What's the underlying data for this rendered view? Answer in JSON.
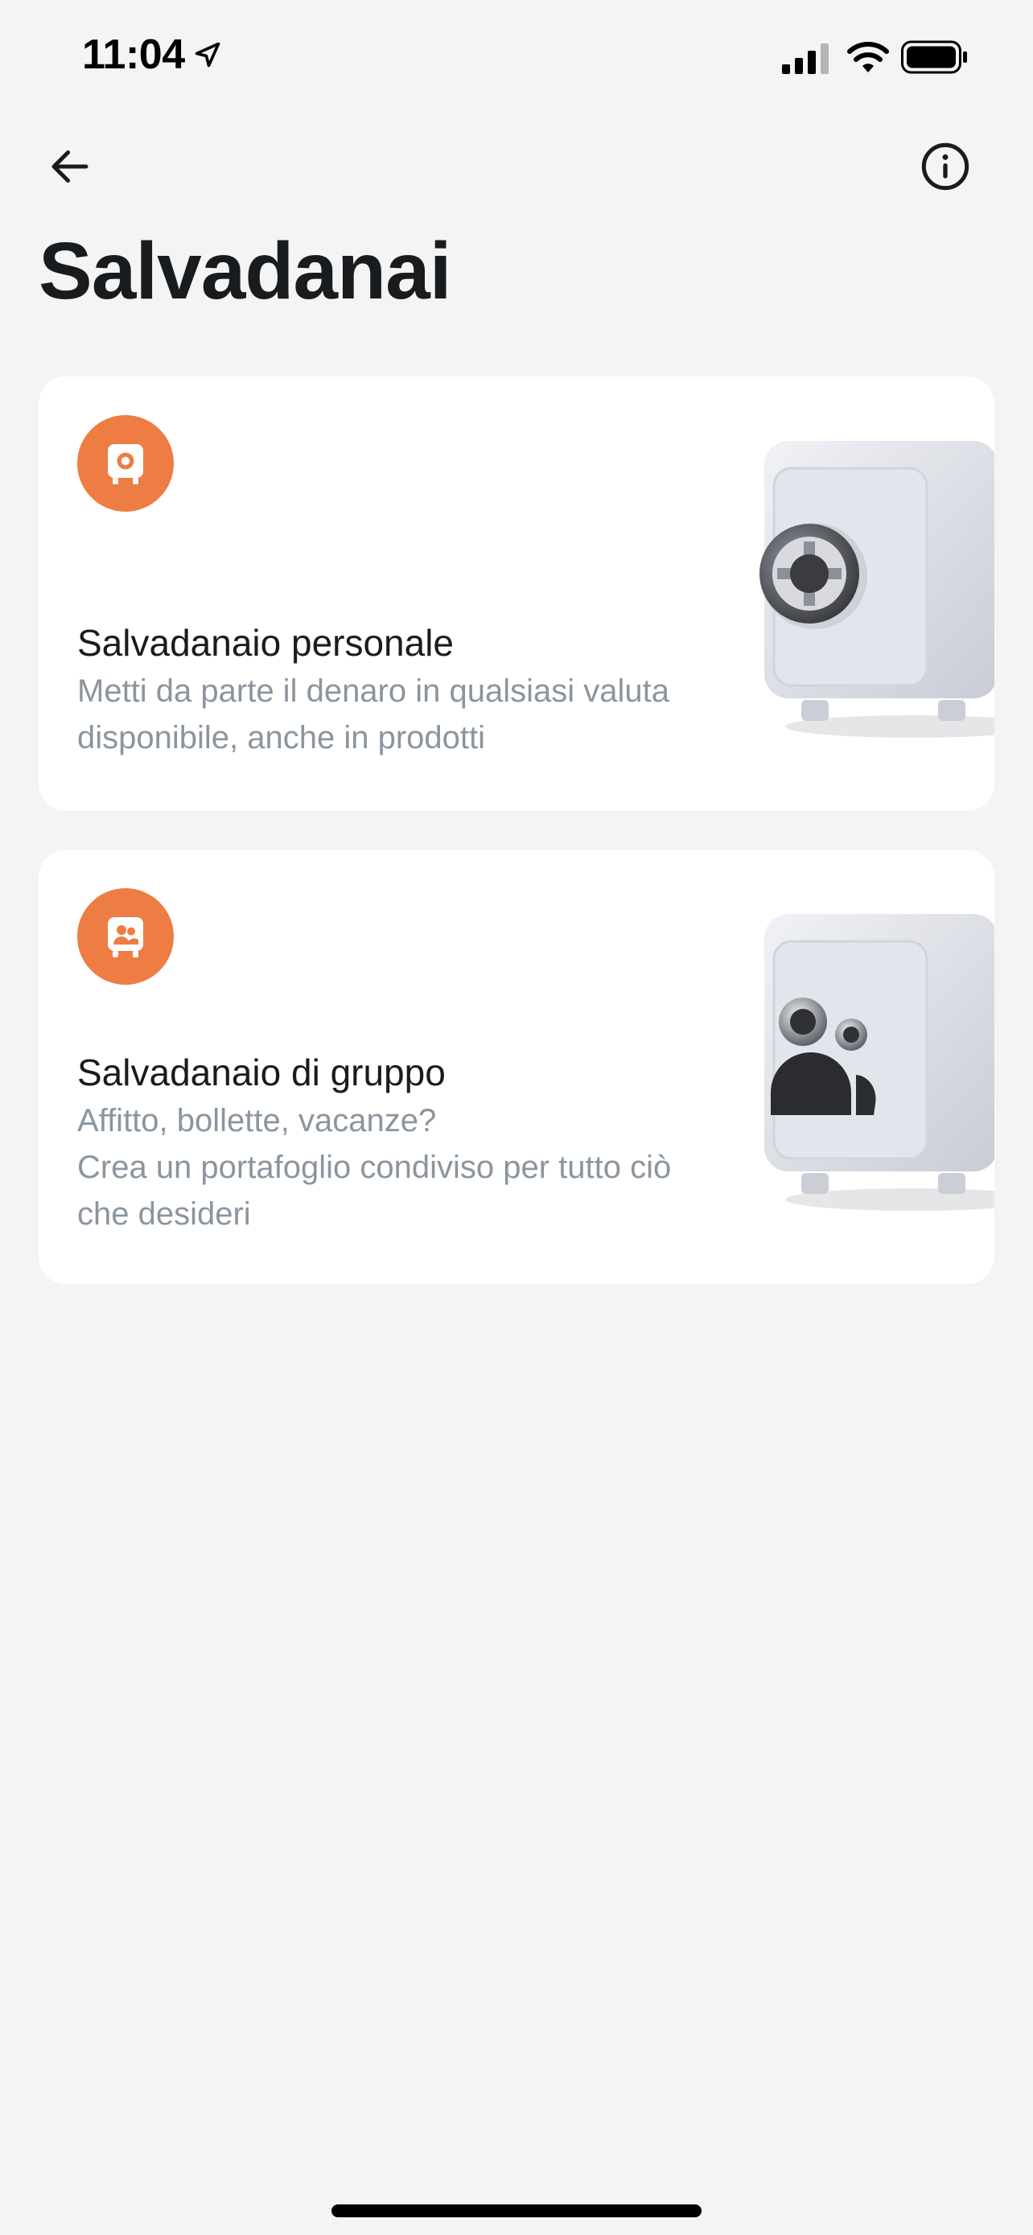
{
  "status_bar": {
    "time": "11:04"
  },
  "nav": {
    "back_icon": "arrow-left-icon",
    "info_icon": "info-circle-icon"
  },
  "page": {
    "title": "Salvadanai"
  },
  "cards": [
    {
      "title": "Salvadanaio personale",
      "description": "Metti da parte il denaro in qualsiasi valuta\ndisponibile, anche in prodotti",
      "icon": "safe-icon"
    },
    {
      "title": "Salvadanaio di gruppo",
      "description": "Affitto, bollette, vacanze?\nCrea un portafoglio condiviso per tutto ciò\nche desideri",
      "icon": "group-safe-icon"
    }
  ],
  "colors": {
    "accent": "#ed7d43",
    "background": "#f4f4f4",
    "card": "#ffffff",
    "text_primary": "#191c1f",
    "text_secondary": "#8b959e"
  }
}
